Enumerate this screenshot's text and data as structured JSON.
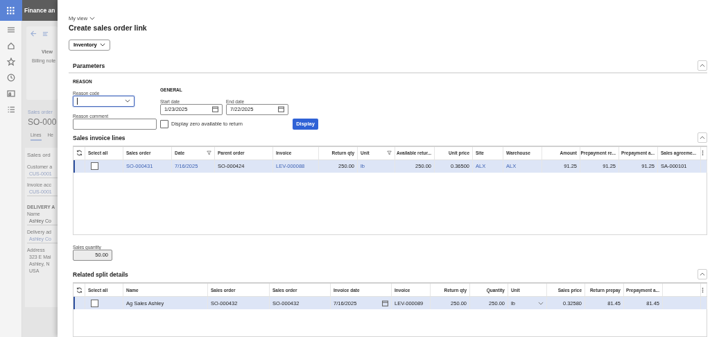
{
  "app": {
    "title": "Finance an"
  },
  "background_page": {
    "view_label": "View",
    "billing_label": "Billing note",
    "breadcrumb": "Sales order",
    "record": "SO-000",
    "tabs": [
      {
        "label": "Lines",
        "selected": true
      },
      {
        "label": "He",
        "selected": false
      }
    ],
    "card_title": "Sales ord",
    "fields": [
      {
        "label": "Customer a",
        "value": "CUS-0001"
      },
      {
        "label": "Invoice acc",
        "value": "CUS-0001"
      }
    ],
    "delivery_heading": "DELIVERY A",
    "delivery_fields": [
      {
        "label": "Name",
        "value": "Ashley Co"
      },
      {
        "label": "Delivery ad",
        "value": "Ashley Co"
      }
    ],
    "address_label": "Address",
    "address_lines": [
      "323 E Mai",
      "Ashley, N",
      "USA"
    ]
  },
  "dialog": {
    "view_menu": "My view",
    "title": "Create sales order link",
    "menu_button": "Inventory"
  },
  "parameters": {
    "title": "Parameters",
    "expanded": true,
    "reason": {
      "heading": "REASON",
      "reason_code": {
        "label": "Reason code",
        "focused": true
      },
      "reason_comment": {
        "label": "Reason comment"
      }
    },
    "general": {
      "heading": "GENERAL",
      "start_date": {
        "label": "Start date",
        "value": "1/23/2025"
      },
      "end_date": {
        "label": "End date",
        "value": "7/22/2025"
      },
      "display_zero": {
        "label": "Display zero available to return",
        "checked": false
      }
    },
    "display_button": "Display"
  },
  "sales_invoice_lines": {
    "title": "Sales invoice lines",
    "expanded": true,
    "select_all_label": "Select all",
    "columns": [
      {
        "label": "Sales order",
        "link": true,
        "filter": false
      },
      {
        "label": "Date",
        "link": true,
        "filter": true
      },
      {
        "label": "Parent order",
        "link": false,
        "filter": false
      },
      {
        "label": "Invoice",
        "link": true,
        "filter": false
      },
      {
        "label": "Return qty",
        "link": false,
        "filter": false
      },
      {
        "label": "Unit",
        "link": true,
        "filter": true
      },
      {
        "label": "Available retur...",
        "link": false,
        "filter": false
      },
      {
        "label": "Unit price",
        "link": false,
        "filter": false
      },
      {
        "label": "Site",
        "link": true,
        "filter": false
      },
      {
        "label": "Warehouse",
        "link": true,
        "filter": false
      },
      {
        "label": "Amount",
        "link": false,
        "filter": false
      },
      {
        "label": "Prepayment re...",
        "link": false,
        "filter": false
      },
      {
        "label": "Prepayment a...",
        "link": false,
        "filter": false
      },
      {
        "label": "Sales agreeme...",
        "link": false,
        "filter": false
      }
    ],
    "rows": [
      {
        "selected": true,
        "checked": false,
        "cells": [
          "SO-000431",
          "7/16/2025",
          "SO-000424",
          "LEV-000088",
          "250.00",
          "lb",
          "250.00",
          "0.36500",
          "ALX",
          "ALX",
          "91.25",
          "91.25",
          "91.25",
          "SA-000101"
        ]
      }
    ]
  },
  "sales_quantity": {
    "label": "Sales quantity",
    "value": "50.00"
  },
  "related_split_details": {
    "title": "Related split details",
    "expanded": true,
    "select_all_label": "Select all",
    "columns": [
      {
        "label": "Name",
        "kind": "text"
      },
      {
        "label": "Sales order",
        "kind": "text"
      },
      {
        "label": "Sales order",
        "kind": "text"
      },
      {
        "label": "Invoice date",
        "kind": "date"
      },
      {
        "label": "Invoice",
        "kind": "text"
      },
      {
        "label": "Return qty",
        "kind": "text"
      },
      {
        "label": "Quantity",
        "kind": "text"
      },
      {
        "label": "Unit",
        "kind": "dropdown"
      },
      {
        "label": "Sales price",
        "kind": "text"
      },
      {
        "label": "Return prepay",
        "kind": "text"
      },
      {
        "label": "Prepayment a...",
        "kind": "text"
      }
    ],
    "rows": [
      {
        "selected": true,
        "checked": false,
        "cells": [
          "Ag Sales Ashley",
          "SO-000432",
          "SO-000432",
          "7/16/2025",
          "LEV-000089",
          "250.00",
          "250.00",
          "lb",
          "0.32580",
          "81.45",
          "81.45"
        ]
      }
    ]
  }
}
